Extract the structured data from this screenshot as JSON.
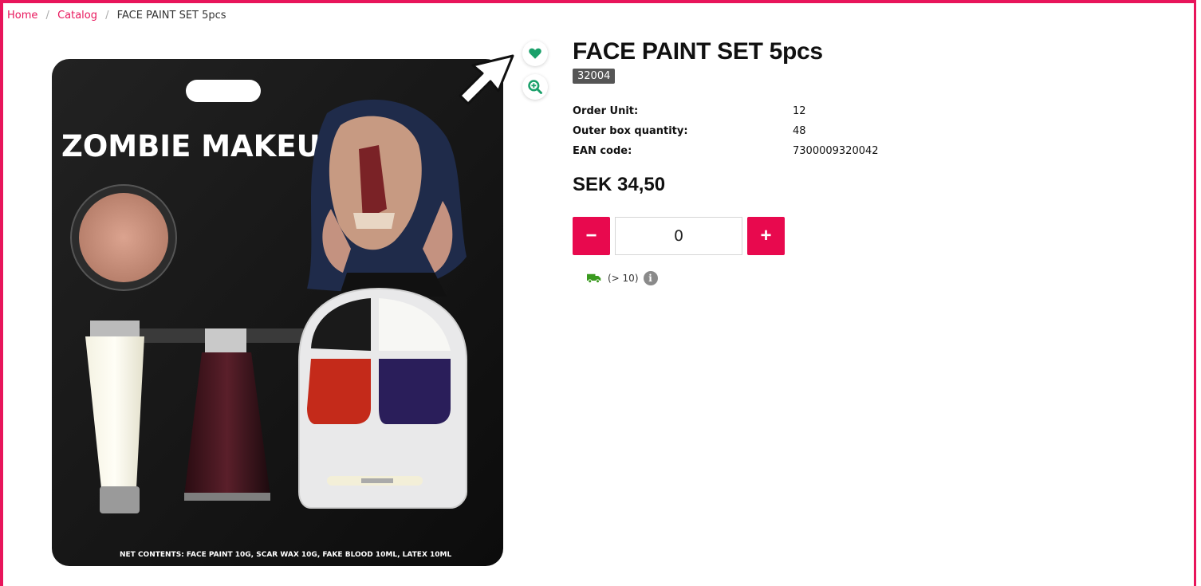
{
  "breadcrumb": {
    "home": "Home",
    "catalog": "Catalog",
    "current": "FACE PAINT SET 5pcs",
    "separator": "/"
  },
  "product": {
    "title": "FACE PAINT SET 5pcs",
    "sku": "32004",
    "specs": [
      {
        "label": "Order Unit:",
        "value": "12"
      },
      {
        "label": "Outer box quantity:",
        "value": "48"
      },
      {
        "label": "EAN code:",
        "value": "7300009320042"
      }
    ],
    "price": "SEK 34,50",
    "quantity": "0",
    "stock": "(> 10)"
  },
  "package": {
    "headline": "ZOMBIE MAKEUP",
    "contents": "NET CONTENTS: FACE PAINT 10G, SCAR WAX 10G, FAKE BLOOD 10ML, LATEX 10ML"
  },
  "icons": {
    "favorite": "heart-icon",
    "zoom": "zoom-in-icon",
    "delivery": "truck-icon",
    "info": "info-icon",
    "cursor": "mouse-pointer-icon"
  },
  "colors": {
    "accent": "#e8155b",
    "button": "#e8094e",
    "favorite": "#1aa06a",
    "delivery": "#3a9a1f"
  },
  "controls": {
    "minus": "−",
    "plus": "+",
    "info": "i"
  }
}
